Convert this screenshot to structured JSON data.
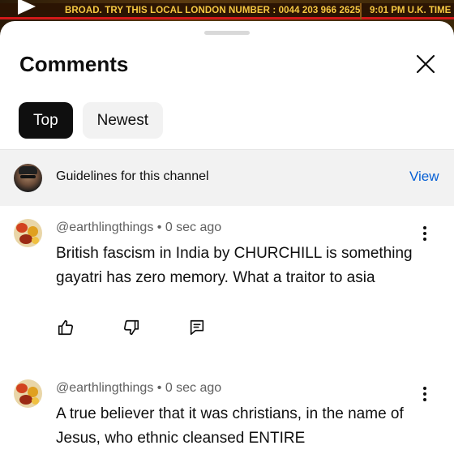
{
  "video": {
    "ticker_text": "BROAD. TRY THIS LOCAL LONDON NUMBER : 0044 203 966 2625",
    "ticker_time": "9:01 PM U.K. TIME"
  },
  "sheet": {
    "title": "Comments",
    "close_icon": "close-icon"
  },
  "sort_chips": [
    {
      "label": "Top",
      "active": true
    },
    {
      "label": "Newest",
      "active": false
    }
  ],
  "guidelines": {
    "text": "Guidelines for this channel",
    "link": "View"
  },
  "comments": [
    {
      "author": "@earthlingthings",
      "time": "0 sec ago",
      "text": "British fascism in India by CHURCHILL is something gayatri has zero memory. What a traitor to asia",
      "actions": [
        "like-icon",
        "dislike-icon",
        "reply-icon"
      ]
    },
    {
      "author": "@earthlingthings",
      "time": "0 sec ago",
      "text": "A true believer that it was christians, in the name of Jesus, who ethnic cleansed ENTIRE",
      "actions": []
    }
  ],
  "colors": {
    "link": "#065fd4",
    "ticker_text": "#f5c842",
    "ticker_bar": "#d21919"
  }
}
